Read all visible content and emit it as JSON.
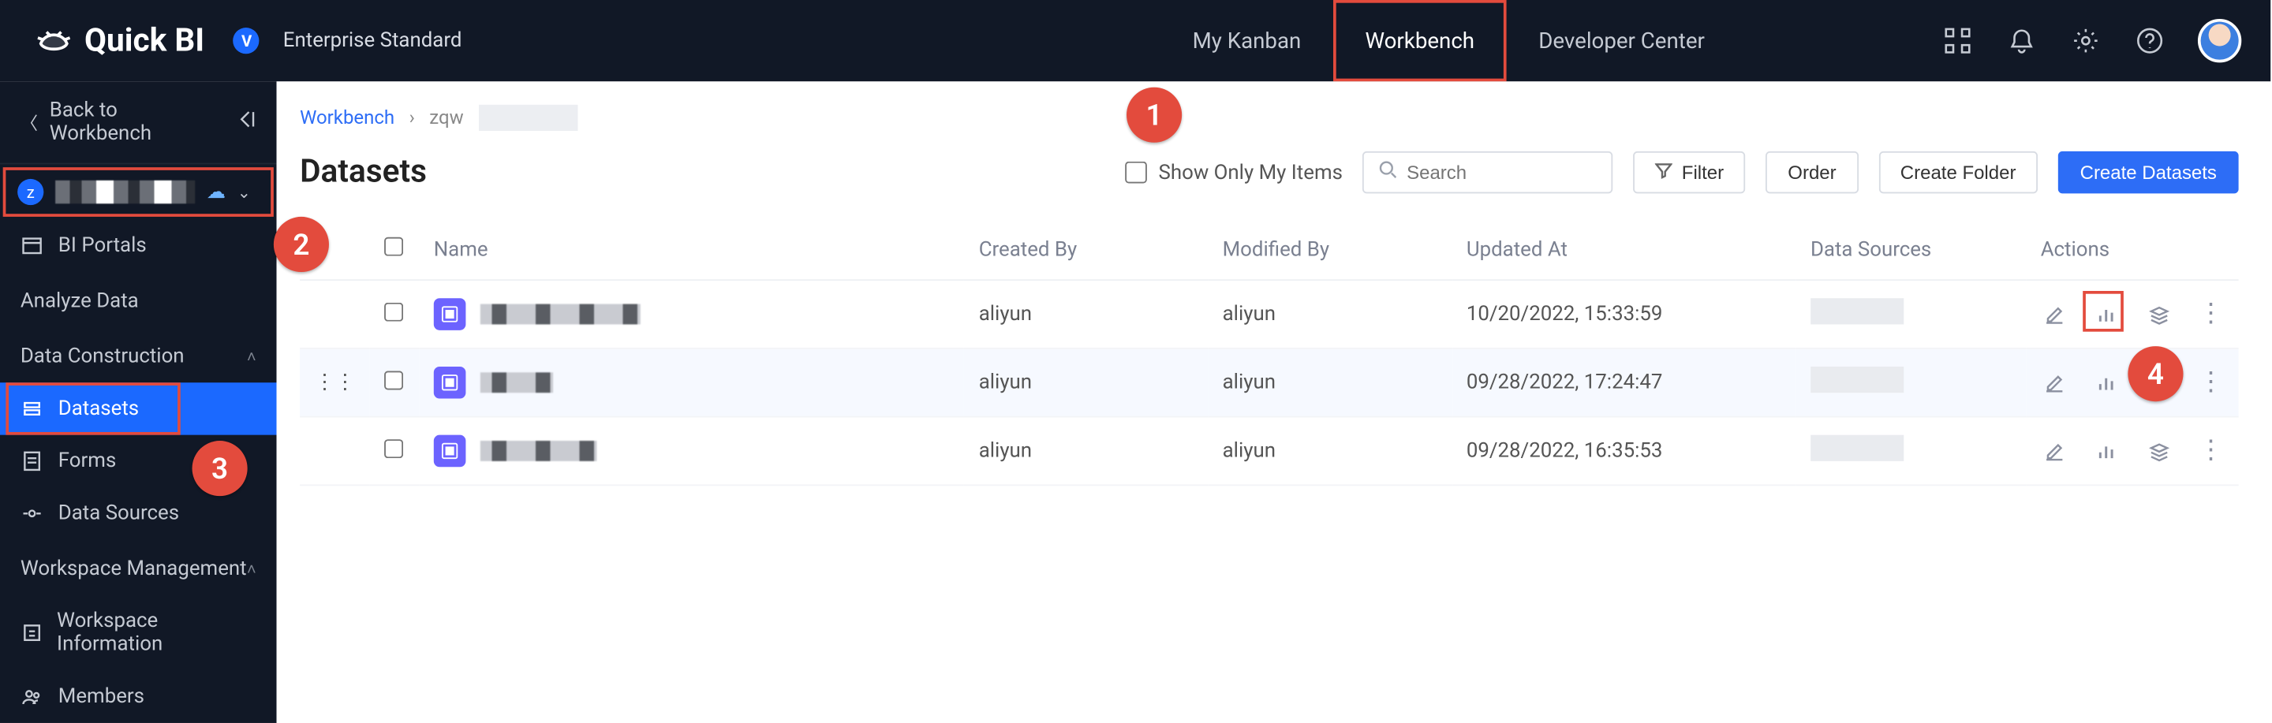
{
  "brand": {
    "name": "Quick BI",
    "tier_badge": "V",
    "tier_label": "Enterprise Standard"
  },
  "topnav": {
    "items": [
      {
        "label": "My Kanban",
        "active": false
      },
      {
        "label": "Workbench",
        "active": true
      },
      {
        "label": "Developer Center",
        "active": false
      }
    ]
  },
  "sidebar": {
    "back_label": "Back to Workbench",
    "workspace_badge": "z",
    "sections": {
      "bi_portals": "BI Portals",
      "analyze_data": "Analyze Data",
      "data_construction": "Data Construction",
      "datasets": "Datasets",
      "forms": "Forms",
      "data_sources": "Data Sources",
      "workspace_management": "Workspace Management",
      "workspace_information": "Workspace Information",
      "members": "Members"
    }
  },
  "breadcrumb": {
    "root": "Workbench",
    "current_prefix": "zqw"
  },
  "page_title": "Datasets",
  "toolbar": {
    "show_only_mine": "Show Only My Items",
    "search_placeholder": "Search",
    "filter": "Filter",
    "order": "Order",
    "create_folder": "Create Folder",
    "create_datasets": "Create Datasets"
  },
  "table": {
    "columns": {
      "name": "Name",
      "created_by": "Created By",
      "modified_by": "Modified By",
      "updated_at": "Updated At",
      "data_sources": "Data Sources",
      "actions": "Actions"
    },
    "rows": [
      {
        "created_by": "aliyun",
        "modified_by": "aliyun",
        "updated_at": "10/20/2022, 15:33:59"
      },
      {
        "created_by": "aliyun",
        "modified_by": "aliyun",
        "updated_at": "09/28/2022, 17:24:47"
      },
      {
        "created_by": "aliyun",
        "modified_by": "aliyun",
        "updated_at": "09/28/2022, 16:35:53"
      }
    ]
  },
  "annotations": {
    "1": "1",
    "2": "2",
    "3": "3",
    "4": "4"
  }
}
